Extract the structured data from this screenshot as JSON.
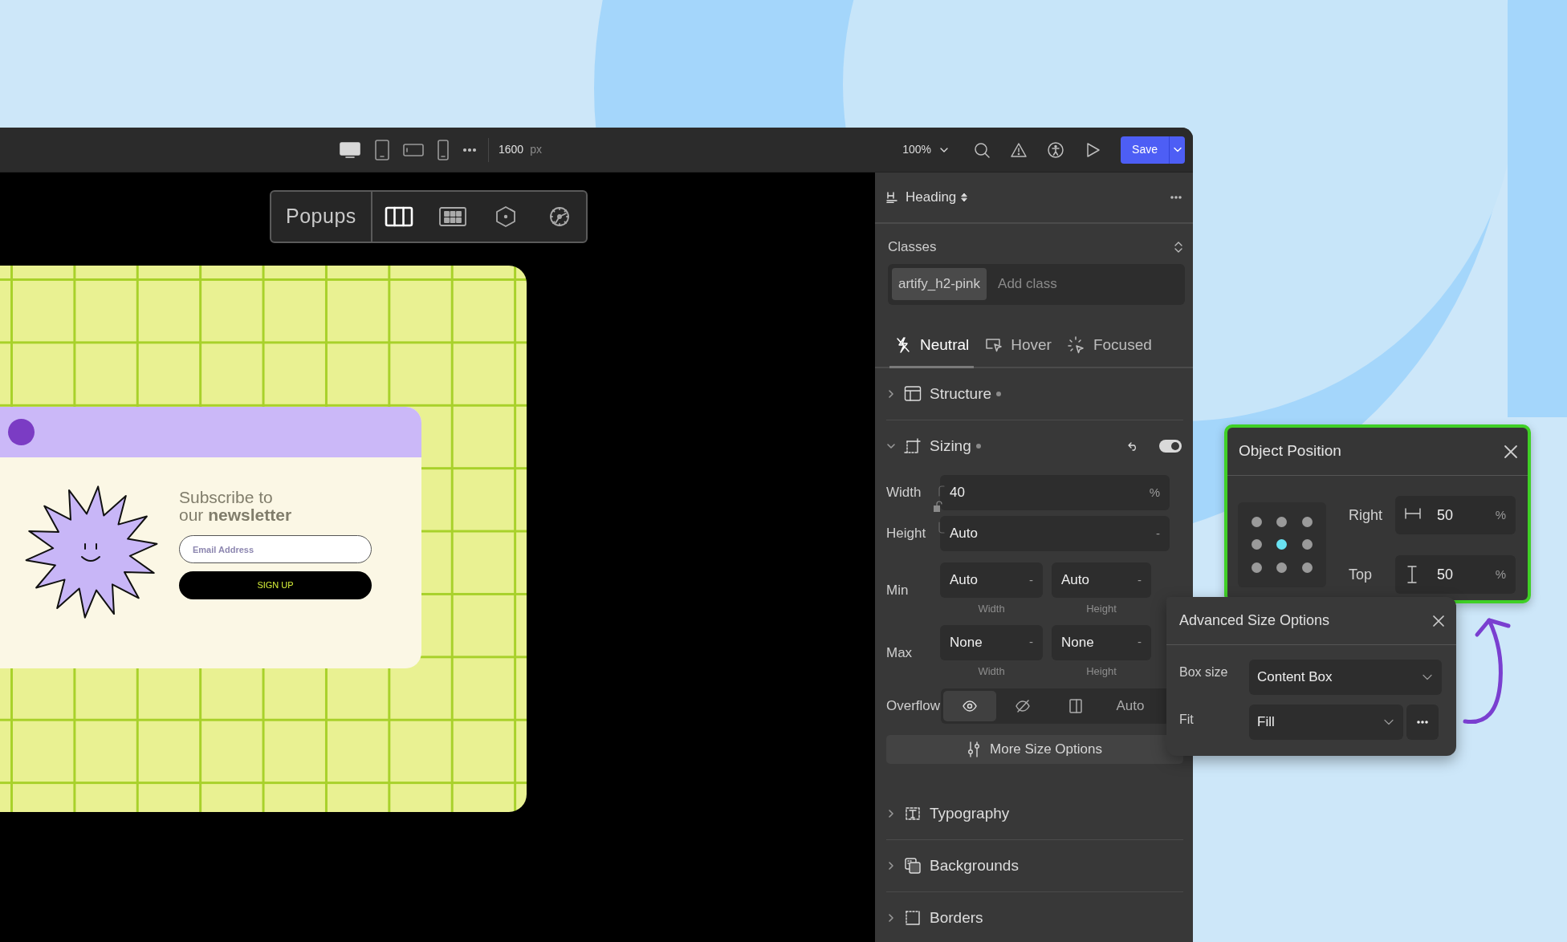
{
  "toolbar": {
    "devices": [
      {
        "kind": "desktop",
        "selected": true
      },
      {
        "kind": "tablet",
        "selected": false
      },
      {
        "kind": "landscape",
        "selected": false
      },
      {
        "kind": "phone",
        "selected": false
      }
    ],
    "width_value": "1600",
    "width_unit": "px",
    "zoom": "100%",
    "save": "Save"
  },
  "canvas": {
    "popup_toolbar": {
      "label": "Popups",
      "tools": [
        {
          "kind": "columns",
          "selected": true
        },
        {
          "kind": "grid",
          "selected": false
        },
        {
          "kind": "cube",
          "selected": false
        },
        {
          "kind": "gear",
          "selected": false
        }
      ]
    },
    "newsletter": {
      "heading": "Subscribe to our **newsletter**",
      "placeholder": "Email Address",
      "button": "SIGN UP"
    }
  },
  "panel": {
    "element": "Heading",
    "classes_title": "Classes",
    "class_tag": "artify_h2-pink",
    "class_placeholder": "Add class",
    "states": [
      {
        "kind": "neutral",
        "label": "Neutral",
        "selected": true
      },
      {
        "kind": "hover",
        "label": "Hover",
        "selected": false
      },
      {
        "kind": "focus",
        "label": "Focused",
        "selected": false
      }
    ],
    "sections": [
      {
        "kind": "structure",
        "title": "Structure",
        "expanded": false,
        "modified": true
      },
      {
        "kind": "sizing",
        "title": "Sizing",
        "expanded": true,
        "modified": true,
        "toggle_on": true,
        "body": {
          "width": {
            "label": "Width",
            "value": "40",
            "unit": "%"
          },
          "height": {
            "label": "Height",
            "value": "Auto",
            "unit": "-"
          },
          "min": {
            "label": "Min",
            "fields": [
              {
                "value": "Auto",
                "unit": "-",
                "caption": "Width"
              },
              {
                "value": "Auto",
                "unit": "-",
                "caption": "Height"
              }
            ]
          },
          "max": {
            "label": "Max",
            "fields": [
              {
                "value": "None",
                "unit": "-",
                "caption": "Width"
              },
              {
                "value": "None",
                "unit": "-",
                "caption": "Height"
              }
            ]
          },
          "overflow": {
            "label": "Overflow",
            "options": [
              {
                "kind": "visible",
                "selected": true
              },
              {
                "kind": "hidden",
                "selected": false
              },
              {
                "kind": "scroll",
                "selected": false
              },
              {
                "kind": "auto",
                "label": "Auto",
                "selected": false
              }
            ]
          },
          "more_button": "More Size Options"
        }
      },
      {
        "kind": "typography",
        "title": "Typography",
        "expanded": false,
        "modified": false
      },
      {
        "kind": "backgrounds",
        "title": "Backgrounds",
        "expanded": false,
        "modified": false
      },
      {
        "kind": "borders",
        "title": "Borders",
        "expanded": false,
        "modified": false
      }
    ]
  },
  "object_position": {
    "title": "Object Position",
    "anchors": [
      {
        "selected": false
      },
      {
        "selected": false
      },
      {
        "selected": false
      },
      {
        "selected": false
      },
      {
        "selected": true
      },
      {
        "selected": false
      },
      {
        "selected": false
      },
      {
        "selected": false
      },
      {
        "selected": false
      }
    ],
    "right": {
      "label": "Right",
      "value": "50",
      "unit": "%"
    },
    "top": {
      "label": "Top",
      "value": "50",
      "unit": "%"
    }
  },
  "advanced_size": {
    "title": "Advanced Size Options",
    "box_size": {
      "label": "Box size",
      "value": "Content Box"
    },
    "fit": {
      "label": "Fit",
      "value": "Fill"
    }
  }
}
